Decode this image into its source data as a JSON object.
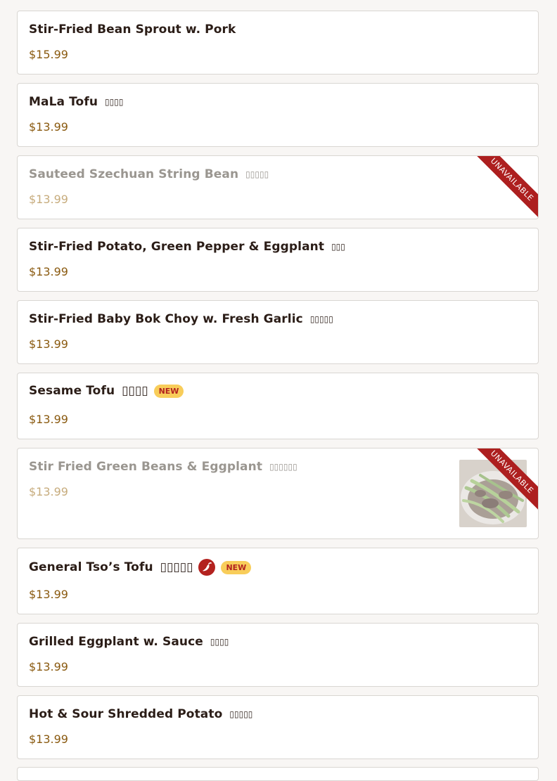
{
  "colors": {
    "background": "#f8f6f4",
    "card": "#ffffff",
    "card_border": "#d9d6d2",
    "item_name": "#2b1d17",
    "price": "#8a5a10",
    "unavailable_text": "#9a9690",
    "unavailable_price": "#c7ac7d",
    "ribbon": "#ad1f1f",
    "new_badge_bg": "#f8cd5a",
    "new_badge_text": "#b3221f",
    "spicy_icon_bg": "#b3221f"
  },
  "ribbon_label": "UNAVAILABLE",
  "new_badge_label": "NEW",
  "items": [
    {
      "name": "Stir-Fried Bean Sprout w. Pork",
      "cjk": "",
      "price": "$15.99",
      "available": true
    },
    {
      "name": "MaLa Tofu",
      "cjk": "▯▯▯▯",
      "price": "$13.99",
      "available": true
    },
    {
      "name": "Sauteed Szechuan String Bean",
      "cjk": "▯▯▯▯▯",
      "price": "$13.99",
      "available": false
    },
    {
      "name": "Stir-Fried Potato, Green Pepper & Eggplant",
      "cjk": "▯▯▯",
      "price": "$13.99",
      "available": true
    },
    {
      "name": "Stir-Fried Baby Bok Choy w. Fresh Garlic",
      "cjk": "▯▯▯▯▯",
      "price": "$13.99",
      "available": true
    },
    {
      "name": "Sesame Tofu",
      "cjk": "▯▯▯▯",
      "price": "$13.99",
      "available": true,
      "is_new": true
    },
    {
      "name": "Stir Fried Green Beans & Eggplant",
      "cjk": "▯▯▯▯▯▯",
      "price": "$13.99",
      "available": false,
      "has_photo": true,
      "photo_icon": "dish-photo-icon"
    },
    {
      "name": "General Tso’s Tofu",
      "cjk": "▯▯▯▯▯",
      "price": "$13.99",
      "available": true,
      "is_new": true,
      "spicy": true,
      "spicy_icon": "chili-pepper-icon"
    },
    {
      "name": "Grilled Eggplant w. Sauce",
      "cjk": "▯▯▯▯",
      "price": "$13.99",
      "available": true
    },
    {
      "name": "Hot & Sour Shredded Potato",
      "cjk": "▯▯▯▯▯",
      "price": "$13.99",
      "available": true
    }
  ]
}
